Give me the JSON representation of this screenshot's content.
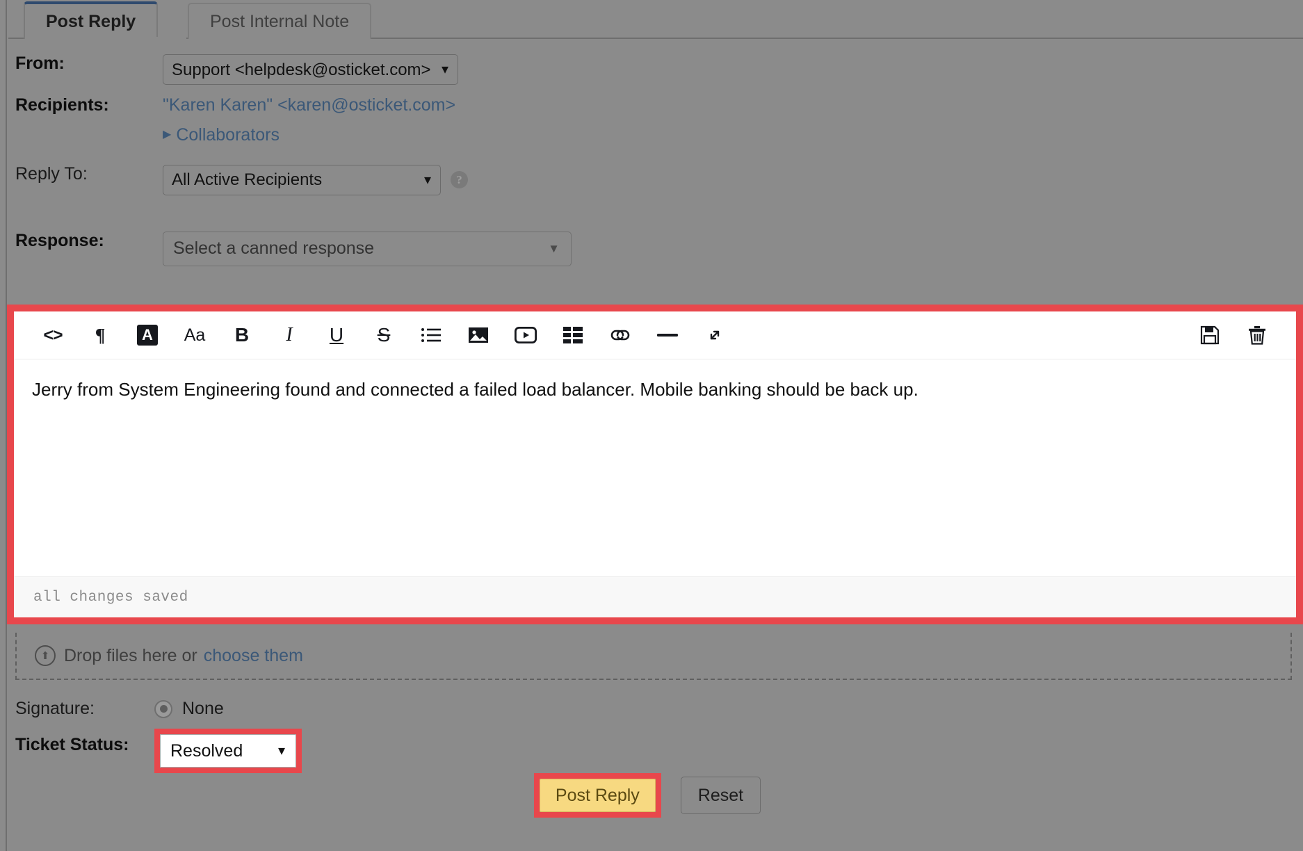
{
  "tabs": [
    {
      "label": "Post Reply",
      "active": true
    },
    {
      "label": "Post Internal Note",
      "active": false
    }
  ],
  "form": {
    "from_label": "From:",
    "from_value": "Support <helpdesk@osticket.com>",
    "recipients_label": "Recipients:",
    "recipients_value": "\"Karen Karen\" <karen@osticket.com>",
    "collaborators_label": "Collaborators",
    "reply_to_label": "Reply To:",
    "reply_to_value": "All Active Recipients",
    "help_glyph": "?",
    "response_label": "Response:",
    "response_placeholder": "Select a canned response",
    "response_caret": "▼"
  },
  "editor": {
    "toolbar": [
      {
        "name": "source-code-icon",
        "glyph": "<>"
      },
      {
        "name": "paragraph-icon",
        "glyph": "¶"
      },
      {
        "name": "text-color-icon",
        "glyph": "A"
      },
      {
        "name": "font-size-icon",
        "glyph": "Aa"
      },
      {
        "name": "bold-icon",
        "glyph": "B"
      },
      {
        "name": "italic-icon",
        "glyph": "I"
      },
      {
        "name": "underline-icon",
        "glyph": "U"
      },
      {
        "name": "strikethrough-icon",
        "glyph": "S"
      },
      {
        "name": "bullet-list-icon",
        "glyph": "list"
      },
      {
        "name": "insert-image-icon",
        "glyph": "image"
      },
      {
        "name": "insert-video-icon",
        "glyph": "video"
      },
      {
        "name": "insert-table-icon",
        "glyph": "table"
      },
      {
        "name": "insert-link-icon",
        "glyph": "link"
      },
      {
        "name": "horizontal-rule-icon",
        "glyph": "—"
      },
      {
        "name": "expand-icon",
        "glyph": "expand"
      }
    ],
    "right_tools": [
      {
        "name": "save-draft-icon",
        "glyph": "save"
      },
      {
        "name": "delete-draft-icon",
        "glyph": "trash"
      }
    ],
    "body_text": "Jerry from System Engineering found and connected a failed load balancer. Mobile banking should be back up.",
    "status_text": "all changes saved"
  },
  "dropzone": {
    "icon_glyph": "⬆",
    "text": "Drop files here or",
    "link": "choose them"
  },
  "signature": {
    "label": "Signature:",
    "option": "None"
  },
  "ticket_status": {
    "label": "Ticket Status:",
    "value": "Resolved"
  },
  "actions": {
    "post_reply": "Post Reply",
    "reset": "Reset"
  },
  "colors": {
    "page_bg": "#8b8b8b",
    "highlight_red": "#e8474c",
    "button_amber": "#f7d981",
    "link_blue": "#3b5878",
    "active_tab_accent": "#2f4a6e"
  }
}
